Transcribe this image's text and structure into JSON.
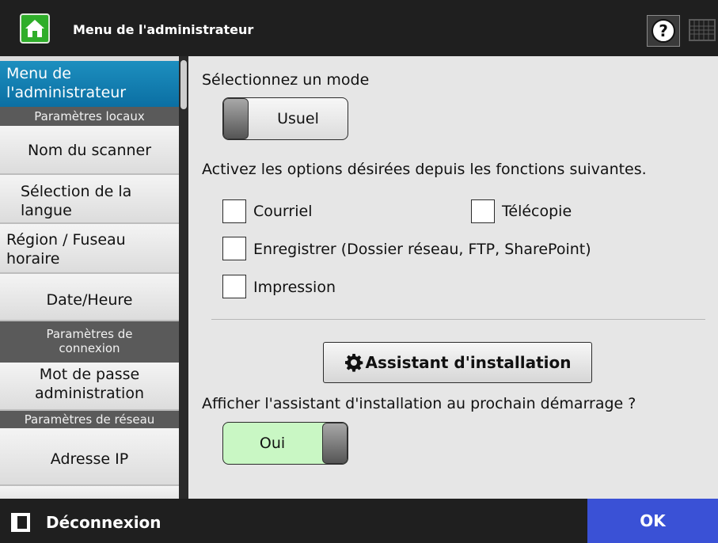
{
  "header": {
    "title": "Menu de l'administrateur",
    "home_icon": "home-icon",
    "help_icon": "help-icon",
    "keyboard_icon": "keyboard-icon"
  },
  "sidebar": {
    "items": [
      {
        "label": "Menu de l'administrateur",
        "type": "item",
        "active": true
      },
      {
        "label": "Paramètres locaux",
        "type": "header"
      },
      {
        "label": "Nom du scanner",
        "type": "item"
      },
      {
        "label": "Sélection de la langue",
        "type": "item"
      },
      {
        "label": "Région / Fuseau horaire",
        "type": "item"
      },
      {
        "label": "Date/Heure",
        "type": "item"
      },
      {
        "label": "Paramètres de connexion",
        "type": "header"
      },
      {
        "label": "Mot de passe administration",
        "type": "item"
      },
      {
        "label": "Paramètres de réseau",
        "type": "header"
      },
      {
        "label": "Adresse IP",
        "type": "item"
      }
    ]
  },
  "main": {
    "mode_label": "Sélectionnez un mode",
    "mode_value": "Usuel",
    "options_label": "Activez les options désirées depuis les fonctions suivantes.",
    "options": [
      {
        "label": "Courriel",
        "checked": false
      },
      {
        "label": "Télécopie",
        "checked": false
      },
      {
        "label": "Enregistrer (Dossier réseau, FTP, SharePoint)",
        "checked": false
      },
      {
        "label": "Impression",
        "checked": false
      }
    ],
    "wizard_button": "Assistant d'installation",
    "wizard_icon": "gear-icon",
    "wizard_prompt": "Afficher l'assistant d'installation au prochain démarrage ?",
    "wizard_toggle_value": "Oui"
  },
  "footer": {
    "logout_label": "Déconnexion",
    "logout_icon": "logout-icon",
    "ok_label": "OK"
  },
  "colors": {
    "active_item": "#1287bb",
    "ok_button": "#3a51d6",
    "toggle_on": "#c9f7c4",
    "home_button": "#2fae2a"
  }
}
